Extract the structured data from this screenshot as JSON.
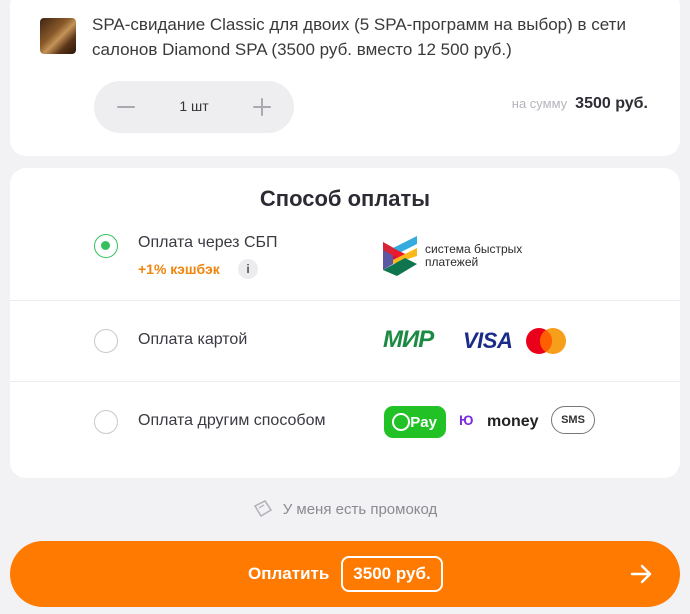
{
  "order": {
    "product_title": "SPA-свидание Classic для двоих (5 SPA-программ на выбор) в сети салонов Diamond SPA (3500 руб. вместо 12 500 руб.)",
    "quantity_label": "1 шт",
    "sum_label": "на сумму",
    "sum_value": "3500 руб."
  },
  "payment": {
    "title": "Способ оплаты",
    "options": [
      {
        "label": "Оплата через СБП",
        "selected": true,
        "cashback": "+1% кэшбэк",
        "info": "i",
        "logo_text_line1": "система быстрых",
        "logo_text_line2": "платежей"
      },
      {
        "label": "Оплата картой",
        "selected": false,
        "logos": [
          "МИР",
          "VISA",
          "mastercard-icon"
        ]
      },
      {
        "label": "Оплата другим способом",
        "selected": false,
        "pay_badge": "Pay",
        "ym_logo": "Ю",
        "ym_text": "money",
        "sms_badge": "SMS"
      }
    ]
  },
  "promo": {
    "label": "У меня есть промокод"
  },
  "pay_button": {
    "label": "Оплатить",
    "amount": "3500 руб."
  },
  "colors": {
    "accent_orange": "#ff7a00",
    "selected_green": "#35c060",
    "cashback_orange": "#f0840c"
  }
}
